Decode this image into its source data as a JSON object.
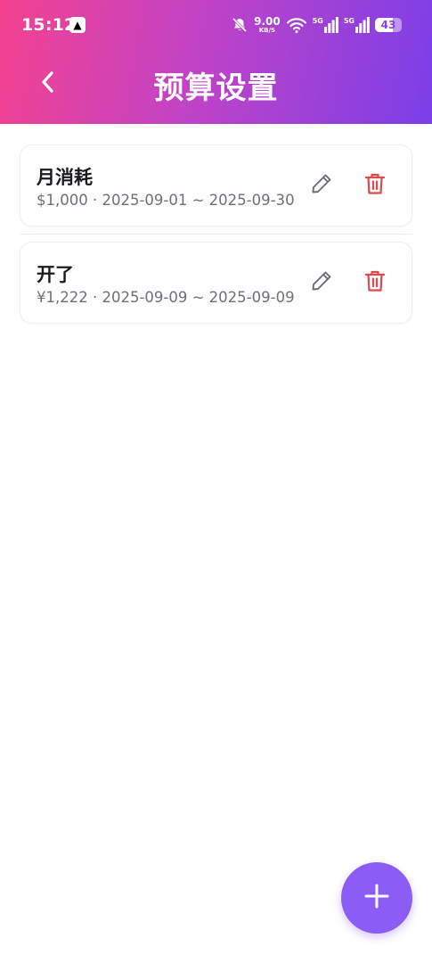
{
  "status_bar": {
    "time": "15:12",
    "app_icon_glyph": "▲",
    "speed_value": "9.00",
    "speed_unit": "KB/S",
    "network_1": "5G",
    "network_2": "5G",
    "battery": "43"
  },
  "header": {
    "title": "预算设置",
    "back_icon": "chevron-left-icon"
  },
  "budgets": [
    {
      "name": "月消耗",
      "meta": "$1,000 · 2025-09-01 ~ 2025-09-30"
    },
    {
      "name": "开了",
      "meta": "¥1,222 · 2025-09-09 ~ 2025-09-09"
    }
  ],
  "icons": {
    "edit": "pencil-icon",
    "delete": "trash-icon",
    "fab": "plus-icon"
  },
  "colors": {
    "gradient_start": "#f4418f",
    "gradient_end": "#7b3fe8",
    "delete": "#e0484c",
    "edit": "#6b6b73",
    "fab": "#8b5cf6"
  }
}
